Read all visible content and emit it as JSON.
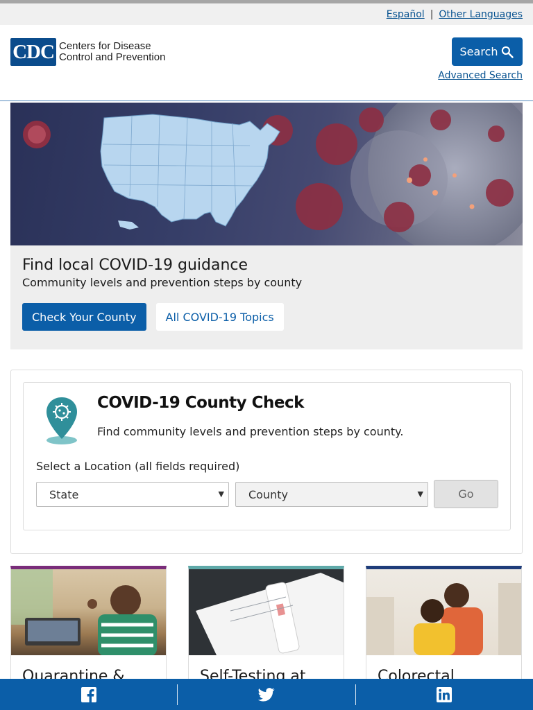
{
  "lang": {
    "espanol": "Español",
    "separator": "|",
    "other": "Other Languages"
  },
  "header": {
    "logo_mark": "CDC",
    "logo_line1": "Centers for Disease",
    "logo_line2": "Control and Prevention",
    "search_label": "Search",
    "advanced_search": "Advanced Search"
  },
  "feature": {
    "title": "Find local COVID-19 guidance",
    "subtitle": "Community levels and prevention steps by county",
    "primary_button": "Check Your County",
    "secondary_button": "All COVID-19 Topics"
  },
  "county_check": {
    "title": "COVID-19 County Check",
    "description": "Find community levels and prevention steps by county.",
    "location_label": "Select a Location (all fields required)",
    "state_select": "State",
    "county_select": "County",
    "go_button": "Go"
  },
  "cards": [
    {
      "title": "Quarantine &",
      "accent": "#7a2d7a"
    },
    {
      "title": "Self-Testing at",
      "accent": "#5fa9a9"
    },
    {
      "title": "Colorectal",
      "accent": "#1f3d7a"
    }
  ],
  "social": {
    "icons": [
      "facebook-icon",
      "twitter-icon",
      "linkedin-icon"
    ]
  },
  "colors": {
    "primary": "#0b5ea8",
    "link": "#075290",
    "feature_bg": "#eeeeee",
    "pin": "#2f8f9a"
  }
}
